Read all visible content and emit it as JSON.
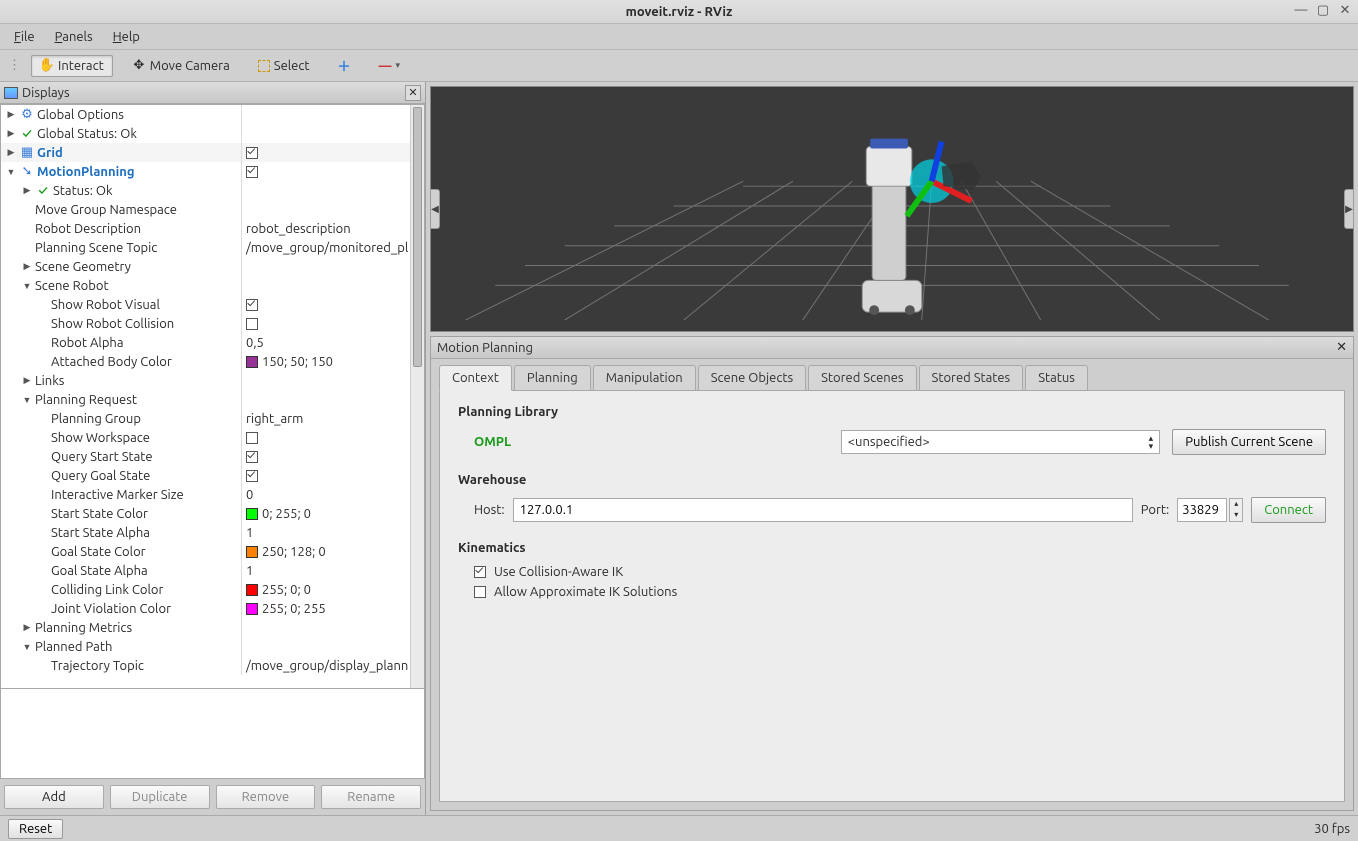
{
  "window": {
    "title": "moveit.rviz - RViz"
  },
  "menubar": {
    "file": "File",
    "panels": "Panels",
    "help": "Help"
  },
  "toolbar": {
    "interact": "Interact",
    "move_camera": "Move Camera",
    "select": "Select"
  },
  "displays": {
    "title": "Displays",
    "rows": [
      {
        "i": 0,
        "tw": "▶",
        "icon": "gear",
        "label": "Global Options",
        "val": ""
      },
      {
        "i": 0,
        "tw": "▶",
        "icon": "check",
        "label": "Global Status: Ok",
        "val": ""
      },
      {
        "i": 0,
        "tw": "▶",
        "icon": "grid",
        "label": "Grid",
        "blue": true,
        "val": "[x]"
      },
      {
        "i": 0,
        "tw": "▼",
        "icon": "mp",
        "label": "MotionPlanning",
        "blue": true,
        "val": "[x]"
      },
      {
        "i": 1,
        "tw": "▶",
        "icon": "check",
        "label": "Status: Ok",
        "val": ""
      },
      {
        "i": 1,
        "tw": "",
        "label": "Move Group Namespace",
        "val": ""
      },
      {
        "i": 1,
        "tw": "",
        "label": "Robot Description",
        "val": "robot_description"
      },
      {
        "i": 1,
        "tw": "",
        "label": "Planning Scene Topic",
        "val": "/move_group/monitored_pl"
      },
      {
        "i": 1,
        "tw": "▶",
        "label": "Scene Geometry",
        "val": ""
      },
      {
        "i": 1,
        "tw": "▼",
        "label": "Scene Robot",
        "val": ""
      },
      {
        "i": 2,
        "tw": "",
        "label": "Show Robot Visual",
        "val": "[x]"
      },
      {
        "i": 2,
        "tw": "",
        "label": "Show Robot Collision",
        "val": "[ ]"
      },
      {
        "i": 2,
        "tw": "",
        "label": "Robot Alpha",
        "val": "0,5"
      },
      {
        "i": 2,
        "tw": "",
        "label": "Attached Body Color",
        "val": "150; 50; 150",
        "color": "#963296"
      },
      {
        "i": 1,
        "tw": "▶",
        "label": "Links",
        "val": ""
      },
      {
        "i": 1,
        "tw": "▼",
        "label": "Planning Request",
        "val": ""
      },
      {
        "i": 2,
        "tw": "",
        "label": "Planning Group",
        "val": "right_arm"
      },
      {
        "i": 2,
        "tw": "",
        "label": "Show Workspace",
        "val": "[ ]"
      },
      {
        "i": 2,
        "tw": "",
        "label": "Query Start State",
        "val": "[x]"
      },
      {
        "i": 2,
        "tw": "",
        "label": "Query Goal State",
        "val": "[x]"
      },
      {
        "i": 2,
        "tw": "",
        "label": "Interactive Marker Size",
        "val": "0"
      },
      {
        "i": 2,
        "tw": "",
        "label": "Start State Color",
        "val": "0; 255; 0",
        "color": "#00ff00"
      },
      {
        "i": 2,
        "tw": "",
        "label": "Start State Alpha",
        "val": "1"
      },
      {
        "i": 2,
        "tw": "",
        "label": "Goal State Color",
        "val": "250; 128; 0",
        "color": "#fa8000"
      },
      {
        "i": 2,
        "tw": "",
        "label": "Goal State Alpha",
        "val": "1"
      },
      {
        "i": 2,
        "tw": "",
        "label": "Colliding Link Color",
        "val": "255; 0; 0",
        "color": "#ff0000"
      },
      {
        "i": 2,
        "tw": "",
        "label": "Joint Violation Color",
        "val": "255; 0; 255",
        "color": "#ff00ff"
      },
      {
        "i": 1,
        "tw": "▶",
        "label": "Planning Metrics",
        "val": ""
      },
      {
        "i": 1,
        "tw": "▼",
        "label": "Planned Path",
        "val": ""
      },
      {
        "i": 2,
        "tw": "",
        "label": "Trajectory Topic",
        "val": "/move_group/display_plann"
      }
    ],
    "buttons": {
      "add": "Add",
      "duplicate": "Duplicate",
      "remove": "Remove",
      "rename": "Rename"
    }
  },
  "mp": {
    "title": "Motion Planning",
    "tabs": [
      "Context",
      "Planning",
      "Manipulation",
      "Scene Objects",
      "Stored Scenes",
      "Stored States",
      "Status"
    ],
    "active_tab": 0,
    "planning_library": {
      "heading": "Planning Library",
      "name": "OMPL",
      "selected": "<unspecified>",
      "publish_btn": "Publish Current Scene"
    },
    "warehouse": {
      "heading": "Warehouse",
      "host_label": "Host:",
      "host": "127.0.0.1",
      "port_label": "Port:",
      "port": "33829",
      "connect": "Connect"
    },
    "kinematics": {
      "heading": "Kinematics",
      "collision_ik": "Use Collision-Aware IK",
      "collision_ik_on": true,
      "approx_ik": "Allow Approximate IK Solutions",
      "approx_ik_on": false
    }
  },
  "statusbar": {
    "reset": "Reset",
    "fps": "30 fps"
  }
}
